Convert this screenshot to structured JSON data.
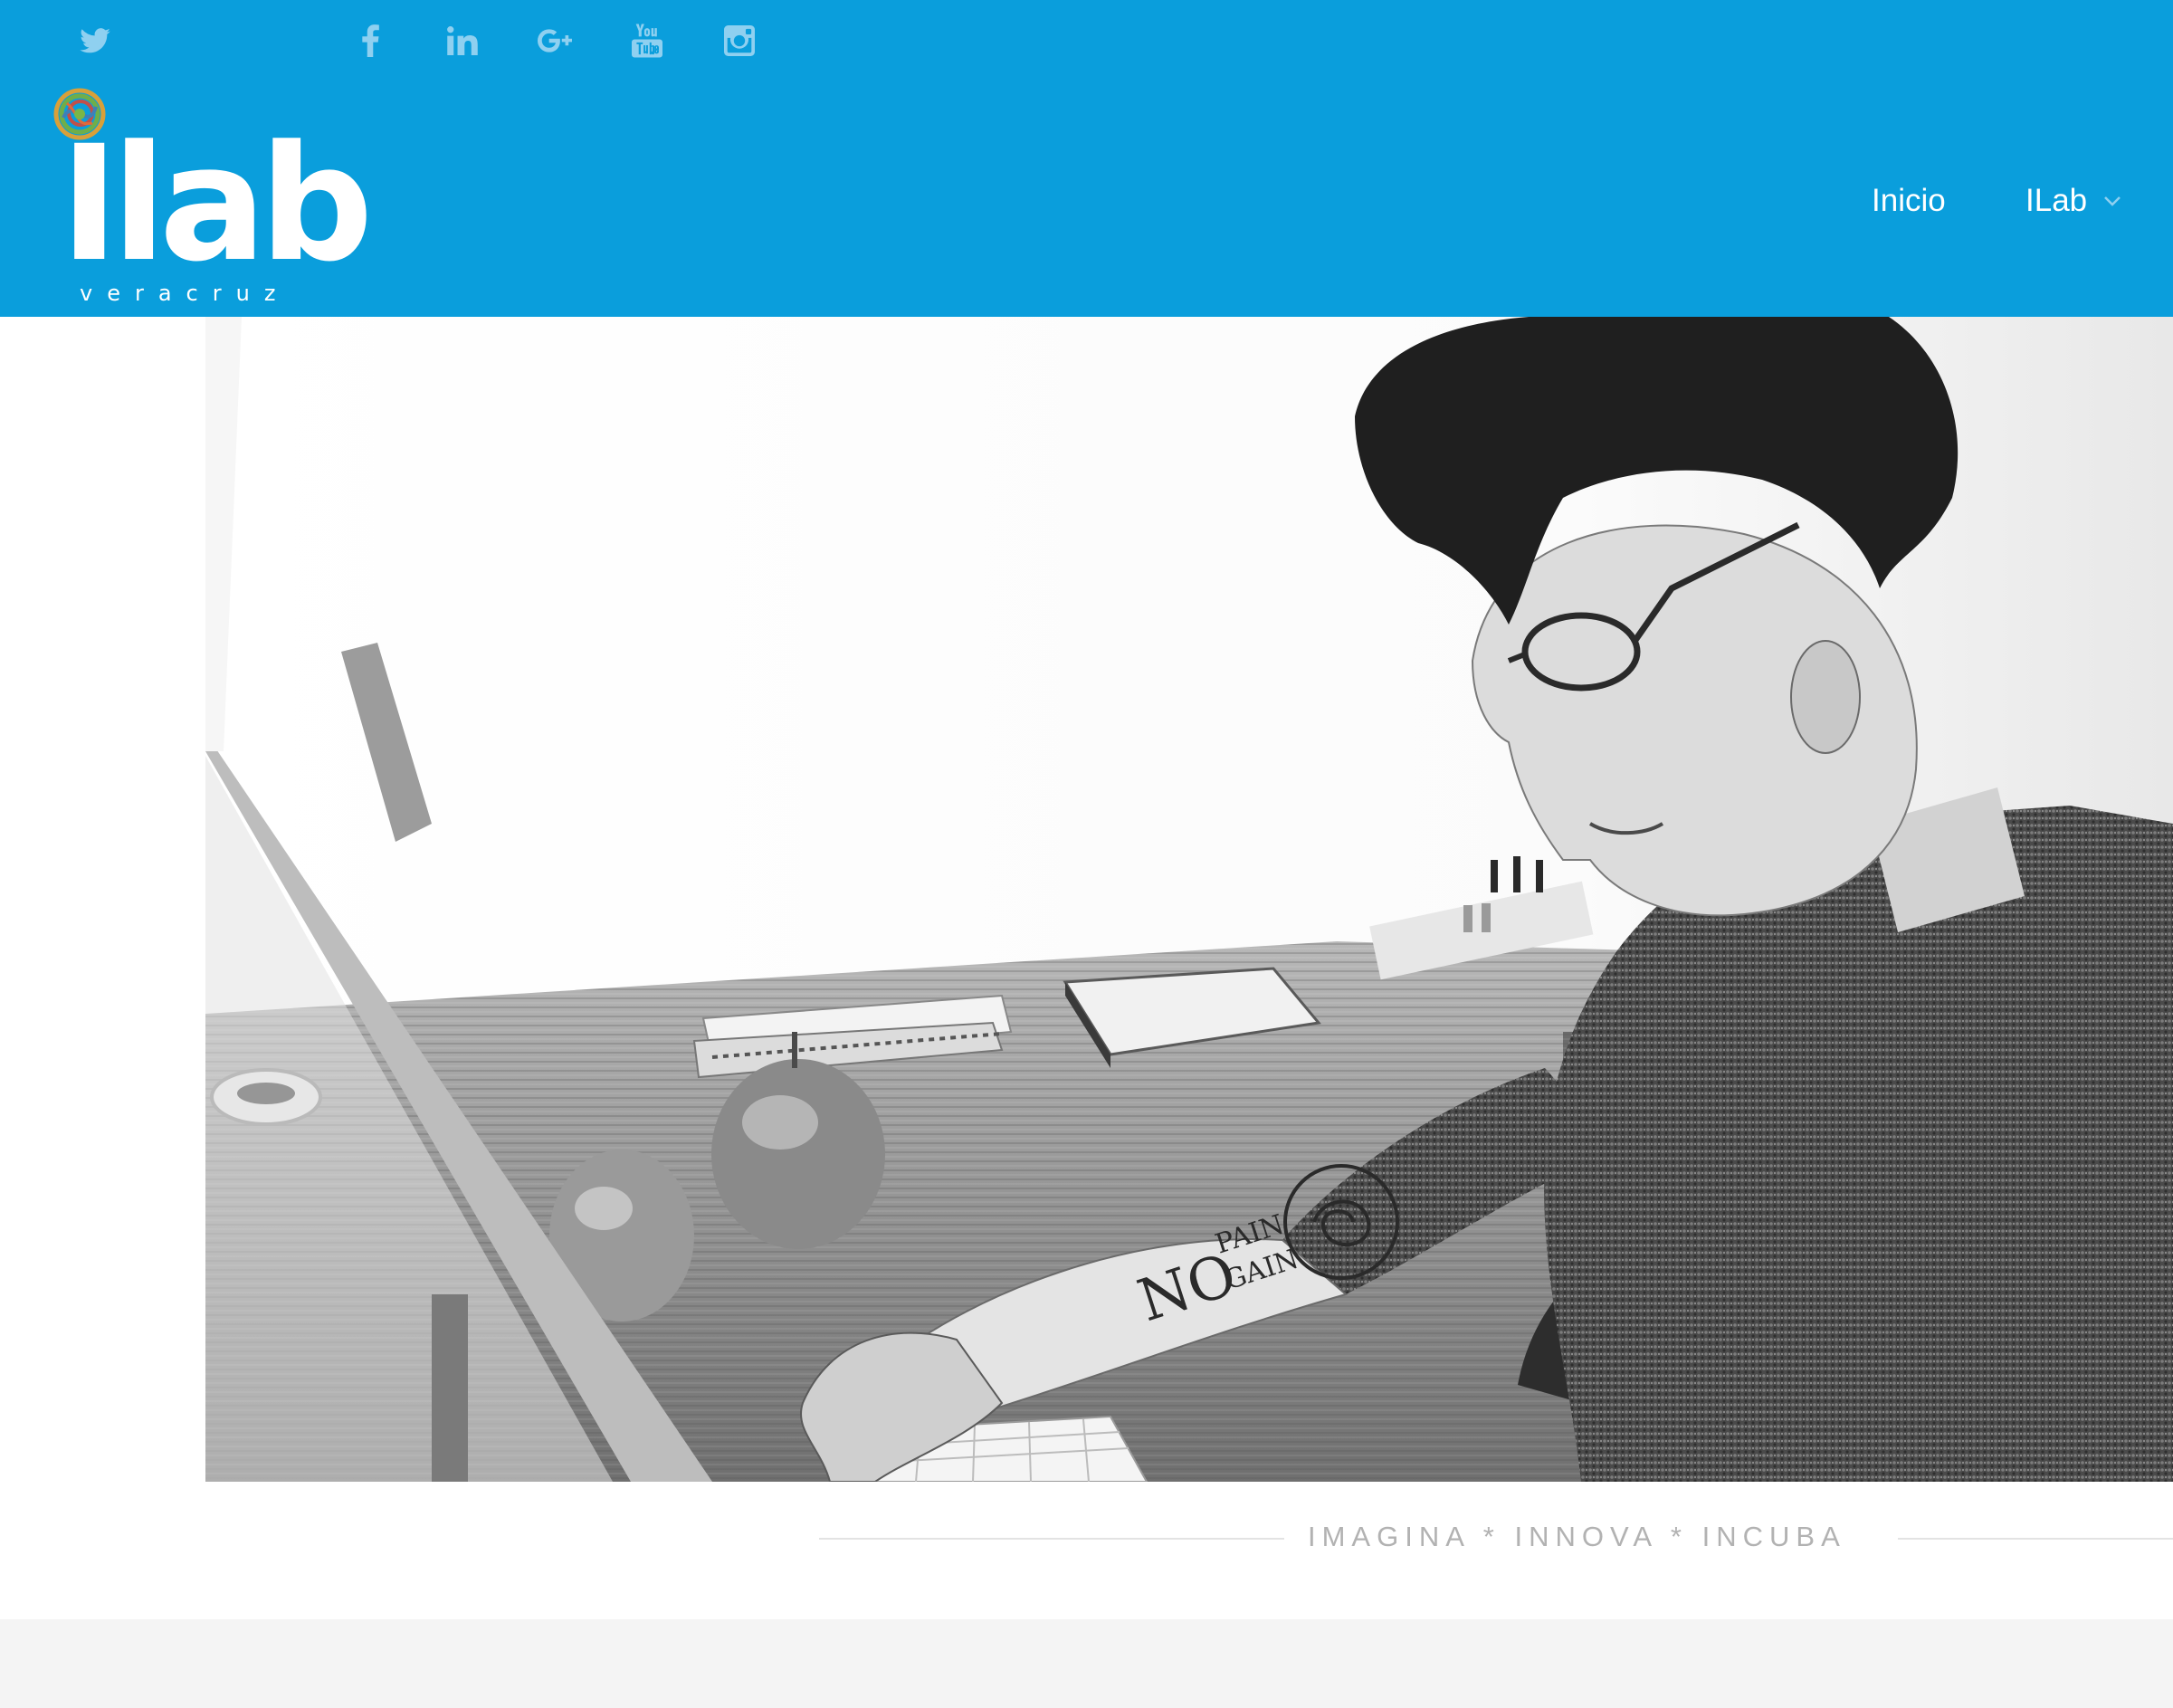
{
  "colors": {
    "brand_blue": "#0a9edc",
    "social_icon": "#8fd0f0",
    "tagline_text": "#b2b2b2",
    "footer_band": "#f4f4f4"
  },
  "social": [
    {
      "name": "twitter",
      "icon": "twitter-icon"
    },
    {
      "name": "facebook",
      "icon": "facebook-icon"
    },
    {
      "name": "linkedin",
      "icon": "linkedin-icon"
    },
    {
      "name": "google-plus",
      "icon": "google-plus-icon"
    },
    {
      "name": "youtube",
      "icon": "youtube-icon"
    },
    {
      "name": "instagram",
      "icon": "instagram-icon"
    }
  ],
  "brand": {
    "logo_text": "Ilab",
    "logo_subtext": "veracruz",
    "logo_mark_icon": "scribble-ball-icon"
  },
  "nav": {
    "items": [
      {
        "label": "Inicio"
      },
      {
        "label": "ILab",
        "has_submenu": true,
        "icon": "chevron-down-icon"
      }
    ]
  },
  "hero": {
    "image": "black-and-white photo of a young man with glasses and a NO PAIN NO GAIN forearm tattoo typing at an iMac on a wooden desk with an apple and notebooks"
  },
  "tagline": {
    "text": "IMAGINA * INNOVA * INCUBA"
  }
}
